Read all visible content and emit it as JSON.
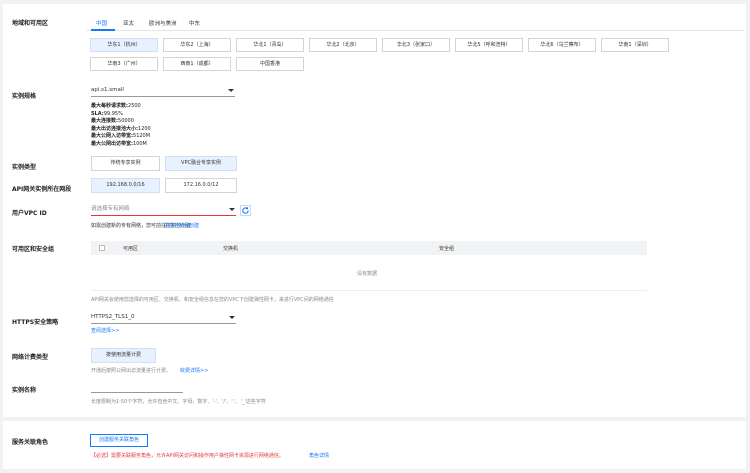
{
  "region": {
    "label": "地域和可用区",
    "tabs": [
      "中国",
      "亚太",
      "欧洲与美洲",
      "中东"
    ],
    "regions_row1": [
      "华东1（杭州）",
      "华东2（上海）",
      "华北1（青岛）",
      "华北2（北京）",
      "华北3（张家口）",
      "华北5（呼和浩特）",
      "华北6（乌兰察布）",
      "华南1（深圳）"
    ],
    "regions_row2": [
      "华南3（广州）",
      "西南1（成都）",
      "中国香港"
    ]
  },
  "spec": {
    "label": "实例规格",
    "value": "api.s1.small",
    "lines": [
      [
        "最大每秒请求数:",
        "2500"
      ],
      [
        "SLA:",
        "99.95%"
      ],
      [
        "最大连接数:",
        "50000"
      ],
      [
        "最大出访连接池大小:",
        "1200"
      ],
      [
        "最大公网入访带宽:",
        "5120M"
      ],
      [
        "最大公网出访带宽:",
        "100M"
      ]
    ]
  },
  "instance_type": {
    "label": "实例类型",
    "options": [
      "传统专享实例",
      "VPC融合专享实例"
    ]
  },
  "segment": {
    "label": "API网关实例所在网段",
    "options": [
      "192.168.0.0/16",
      "172.16.0.0/12"
    ]
  },
  "vpc": {
    "label": "用户VPC ID",
    "placeholder": "请选择专有网络",
    "hint": "如需创建新的专有网络，您可前往控制台创建"
  },
  "zone": {
    "label": "可用区和安全组",
    "columns": [
      "可用区",
      "交换机",
      "安全组"
    ],
    "empty": "没有数据",
    "note": "API网关会使用您选择的可用区、交换机、和安全组信息在您的VPC下创建弹性网卡，来进行VPC间的网络通信"
  },
  "https": {
    "label": "HTTPS安全策略",
    "value": "HTTPS2_TLS1_0",
    "link": "查阅选择>>"
  },
  "billing": {
    "label": "网络计费类型",
    "option": "按使用流量计费",
    "note": "开通后按照公网出访流量进行计费。",
    "link": "收费详情>>"
  },
  "name": {
    "label": "实例名称",
    "hint": "长度限制为1-50个字符，允许包含中文、字母、数字、'-'、'/'、'.'、'_'这些字符"
  },
  "role": {
    "label": "服务关联角色",
    "button": "创建服务关联角色",
    "warning": "【必选】需要关联服务角色，允许API网关访问和操作用户弹性网卡资源进行网络通信。",
    "link": "角色详情"
  },
  "colors": {
    "accent": "#1677ff",
    "warning": "#e4393c"
  }
}
